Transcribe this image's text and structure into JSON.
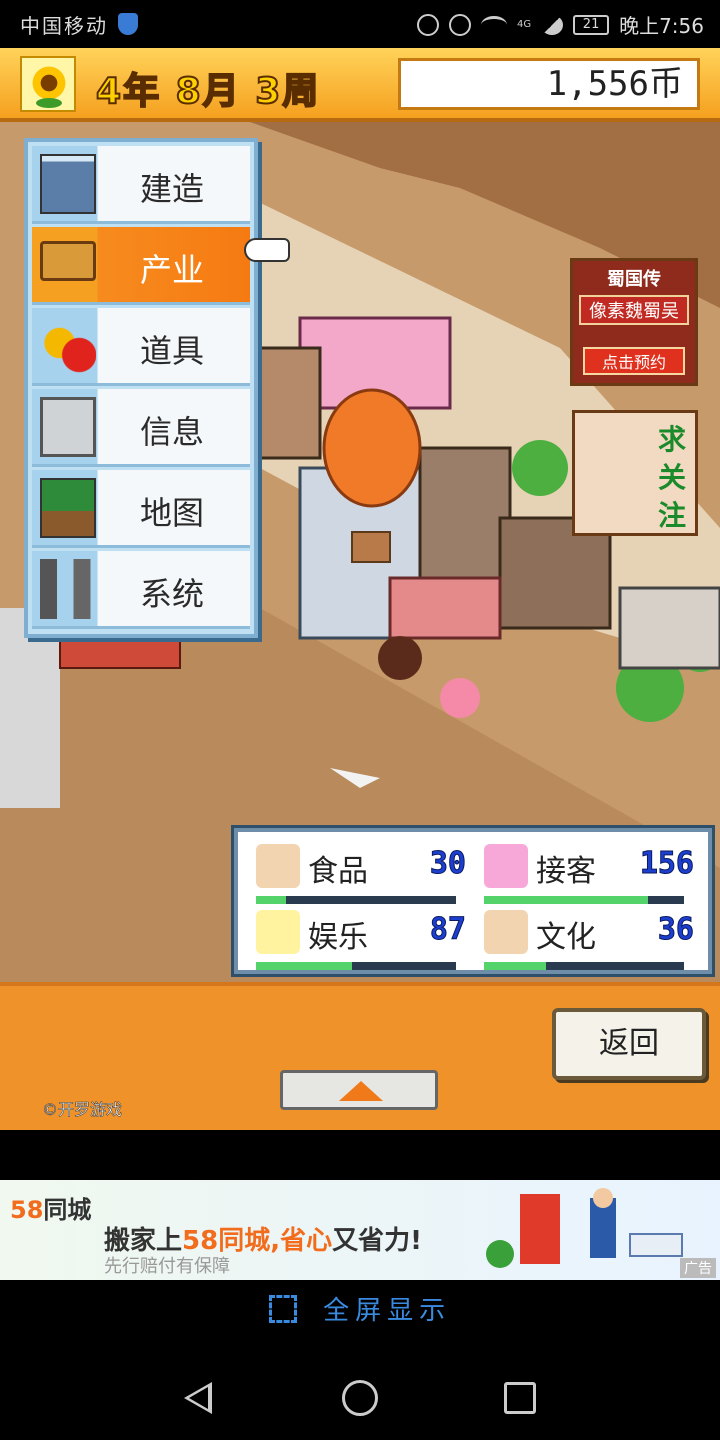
{
  "status_bar": {
    "carrier": "中国移动",
    "network": "4G",
    "battery": "21",
    "time": "晚上7:56"
  },
  "game": {
    "date": {
      "year": "4",
      "year_unit": "年",
      "month": "8",
      "month_unit": "月",
      "week": "3",
      "week_unit": "周"
    },
    "coins": "1,556币",
    "menu": {
      "items": [
        {
          "label": "建造",
          "icon": "building-icon"
        },
        {
          "label": "产业",
          "icon": "signboard-icon",
          "active": true
        },
        {
          "label": "道具",
          "icon": "fruit-icon"
        },
        {
          "label": "信息",
          "icon": "computer-icon"
        },
        {
          "label": "地图",
          "icon": "map-icon"
        },
        {
          "label": "系统",
          "icon": "tools-icon"
        }
      ]
    },
    "promo_ads": [
      {
        "title": "蜀国传",
        "subtitle": "像素魏蜀吴",
        "cta": "点击预约"
      },
      {
        "text": "求关注"
      }
    ],
    "stats": [
      {
        "label": "食品",
        "value": "30",
        "icon": "rice-ball-icon",
        "fill": 0.15
      },
      {
        "label": "接客",
        "value": "156",
        "icon": "heart-icon",
        "fill": 0.82
      },
      {
        "label": "娱乐",
        "value": "87",
        "icon": "sparkle-icon",
        "fill": 0.48
      },
      {
        "label": "文化",
        "value": "36",
        "icon": "book-icon",
        "fill": 0.31
      }
    ],
    "back_label": "返回",
    "copyright": "©开罗游戏"
  },
  "banner_ad": {
    "brand_num": "58",
    "brand_text": "同城",
    "slogan_pre": "搬家上",
    "slogan_hl": "58同城,省心",
    "slogan_post": "又省力!",
    "sub": "先行赔付有保障",
    "ad_tag": "广告"
  },
  "fullscreen_label": "全屏显示",
  "colors": {
    "accent_orange": "#f57a12",
    "menu_blue": "#bfe0f2",
    "stat_value_blue": "#1c3fd0",
    "stat_bar_green": "#53d36a"
  }
}
